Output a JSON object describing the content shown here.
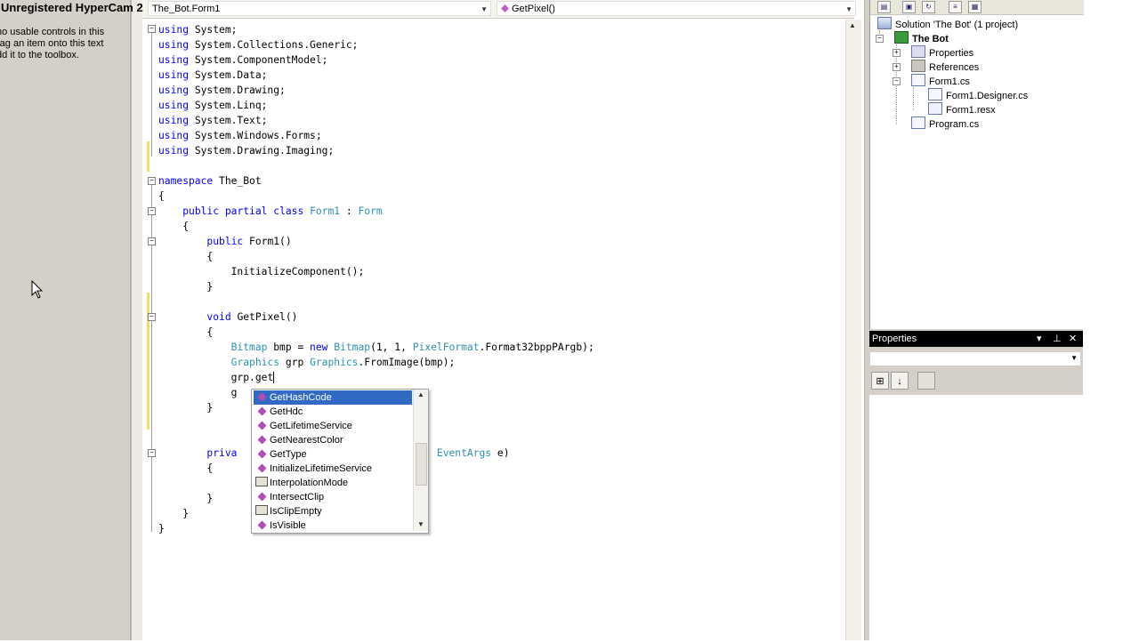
{
  "watermark": "Unregistered HyperCam 2",
  "toolbox": {
    "message_lines": [
      "no usable controls in this",
      "rag an item onto this text",
      "dd it to the toolbox."
    ]
  },
  "editor": {
    "type_dropdown": "The_Bot.Form1",
    "member_dropdown": "GetPixel()"
  },
  "intellisense": {
    "items": [
      {
        "label": "GetHashCode",
        "kind": "method",
        "selected": true
      },
      {
        "label": "GetHdc",
        "kind": "method"
      },
      {
        "label": "GetLifetimeService",
        "kind": "method"
      },
      {
        "label": "GetNearestColor",
        "kind": "method"
      },
      {
        "label": "GetType",
        "kind": "method"
      },
      {
        "label": "InitializeLifetimeService",
        "kind": "method"
      },
      {
        "label": "InterpolationMode",
        "kind": "property"
      },
      {
        "label": "IntersectClip",
        "kind": "method"
      },
      {
        "label": "IsClipEmpty",
        "kind": "property"
      },
      {
        "label": "IsVisible",
        "kind": "method"
      }
    ]
  },
  "solution_explorer": {
    "solution": "Solution 'The Bot' (1 project)",
    "project": "The Bot",
    "items": {
      "properties": "Properties",
      "references": "References",
      "form1": "Form1.cs",
      "form1_designer": "Form1.Designer.cs",
      "form1_resx": "Form1.resx",
      "program": "Program.cs"
    }
  },
  "properties_panel": {
    "title": "Properties"
  },
  "colors": {
    "keyword": "#0000ff",
    "type": "#2b91af",
    "selection": "#316ac5"
  }
}
